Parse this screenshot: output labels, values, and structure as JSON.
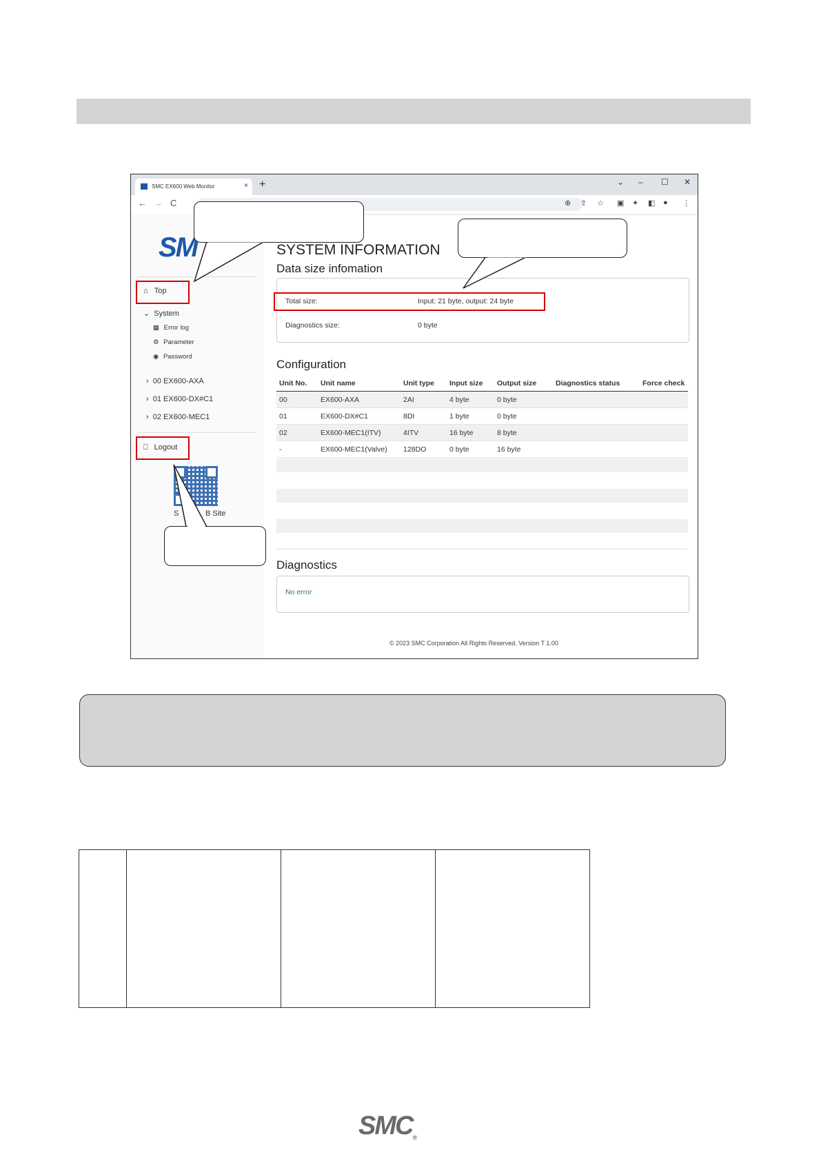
{
  "browser": {
    "tab_title": "SMC EX600 Web Monitor",
    "close_tab": "×",
    "new_tab": "+",
    "window_controls": [
      "⌄",
      "–",
      "☐",
      "✕"
    ],
    "nav": [
      "←",
      "→",
      "C"
    ]
  },
  "sidebar": {
    "logo_text": "SM",
    "top_label": "Top",
    "system_label": "System",
    "system_items": [
      "Error log",
      "Parameter",
      "Password"
    ],
    "units": [
      "00 EX600-AXA",
      "01 EX600-DX#C1",
      "02 EX600-MEC1"
    ],
    "logout_label": "Logout",
    "qr_caption_left": "S",
    "qr_caption_right": "B Site"
  },
  "main": {
    "title": "SYSTEM INFORMATION",
    "data_size_heading": "Data size infomation",
    "total_size_label": "Total size:",
    "total_size_value": "Input: 21 byte, output: 24 byte",
    "diag_size_label": "Diagnostics size:",
    "diag_size_value": "0 byte",
    "config_heading": "Configuration",
    "config_columns": [
      "Unit No.",
      "Unit name",
      "Unit type",
      "Input size",
      "Output size",
      "Diagnostics status",
      "Force check"
    ],
    "config_rows": [
      [
        "00",
        "EX600-AXA",
        "2AI",
        "4 byte",
        "0 byte",
        "",
        ""
      ],
      [
        "01",
        "EX600-DX#C1",
        "8DI",
        "1 byte",
        "0 byte",
        "",
        ""
      ],
      [
        "02",
        "EX600-MEC1(ITV)",
        "4ITV",
        "16 byte",
        "8 byte",
        "",
        ""
      ],
      [
        "-",
        "EX600-MEC1(Valve)",
        "128DO",
        "0 byte",
        "16 byte",
        "",
        ""
      ]
    ],
    "diagnostics_heading": "Diagnostics",
    "diagnostics_text": "No error",
    "copyright": "© 2023 SMC Corporation All Rights Reserved. Version T 1.00"
  },
  "footer": {
    "logo_text": "SMC",
    "registered": "®"
  },
  "colors": {
    "smc_blue": "#1d58a8",
    "highlight_red": "#d40000",
    "header_gray": "#d4d4d4"
  }
}
